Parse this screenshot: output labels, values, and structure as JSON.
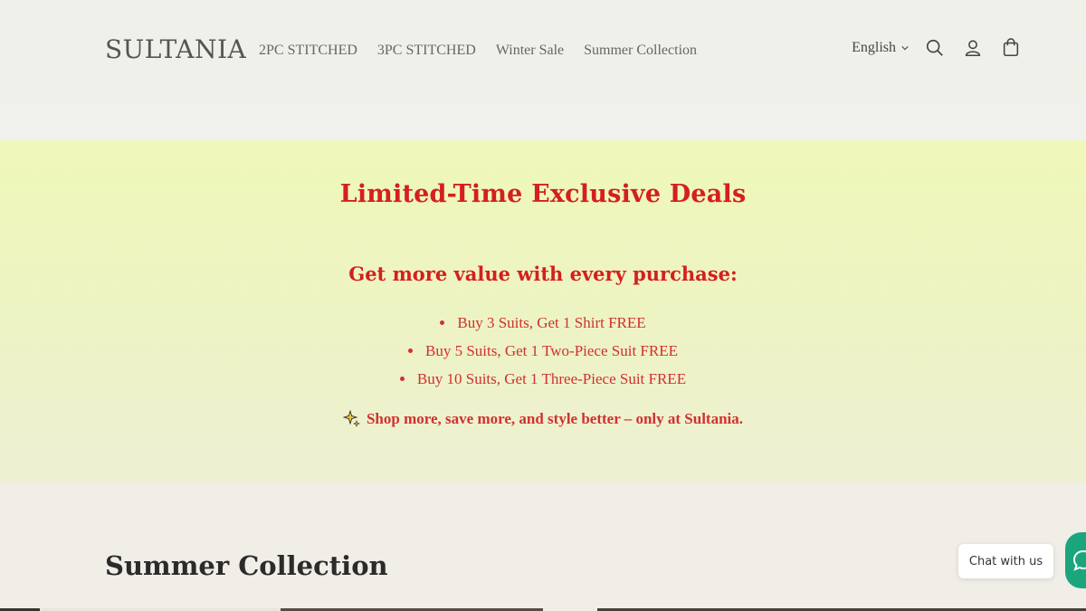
{
  "header": {
    "logo": "SULTANIA",
    "nav": [
      "2PC STITCHED",
      "3PC STITCHED",
      "Winter Sale",
      "Summer Collection"
    ],
    "language": "English",
    "icons": [
      "search-icon",
      "account-icon",
      "cart-icon"
    ]
  },
  "promo": {
    "title": "Limited-Time Exclusive Deals",
    "subtitle": "Get more value with every purchase:",
    "offers": [
      "Buy 3 Suits, Get 1 Shirt FREE",
      "Buy 5 Suits, Get 1 Two-Piece Suit FREE",
      "Buy 10 Suits, Get 1 Three-Piece Suit FREE"
    ],
    "tagline": "Shop more, save more, and style better – only at Sultania.",
    "tagline_icon": "sparkle-icon",
    "accent_color": "#d41f1f"
  },
  "section": {
    "title": "Summer Collection"
  },
  "chat": {
    "label": "Chat with us",
    "launcher_color": "#1aa57d"
  }
}
